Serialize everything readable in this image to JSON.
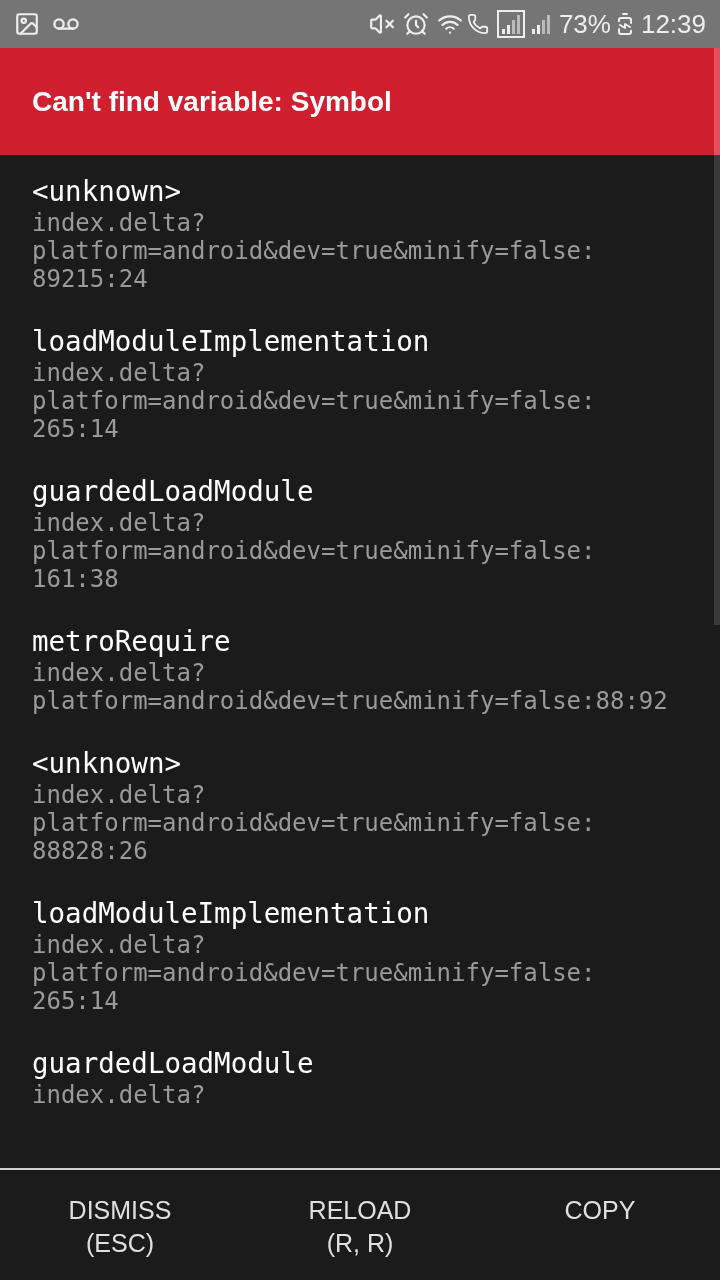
{
  "status_bar": {
    "battery": "73%",
    "time": "12:39"
  },
  "header": {
    "title": "Can't find variable: Symbol"
  },
  "stack_frames": [
    {
      "method": "<unknown>",
      "location": [
        "index.delta?",
        "platform=android&dev=true&minify=false:",
        "89215:24"
      ]
    },
    {
      "method": "loadModuleImplementation",
      "location": [
        "index.delta?",
        "platform=android&dev=true&minify=false:",
        "265:14"
      ]
    },
    {
      "method": "guardedLoadModule",
      "location": [
        "index.delta?",
        "platform=android&dev=true&minify=false:",
        "161:38"
      ]
    },
    {
      "method": "metroRequire",
      "location": [
        "index.delta?",
        "platform=android&dev=true&minify=false:88:92"
      ]
    },
    {
      "method": "<unknown>",
      "location": [
        "index.delta?",
        "platform=android&dev=true&minify=false:",
        "88828:26"
      ]
    },
    {
      "method": "loadModuleImplementation",
      "location": [
        "index.delta?",
        "platform=android&dev=true&minify=false:",
        "265:14"
      ]
    },
    {
      "method": "guardedLoadModule",
      "location": [
        "index.delta?"
      ]
    }
  ],
  "buttons": [
    [
      "DISMISS",
      "(ESC)"
    ],
    [
      "RELOAD",
      "(R, R)"
    ],
    [
      "COPY"
    ]
  ]
}
